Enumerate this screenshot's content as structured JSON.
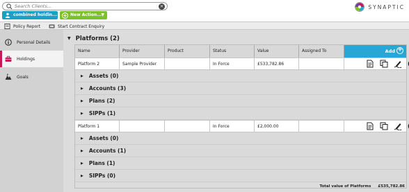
{
  "topbar": {
    "search": {
      "placeholder": "Search Clients...",
      "value": ""
    },
    "client_button": "combined holdin...",
    "action_button": "New Action...",
    "brand": "SYNAPTIC"
  },
  "toolbar": {
    "items": [
      {
        "label": "Policy Report",
        "icon": "report-icon"
      },
      {
        "label": "Start Contract Enquiry",
        "icon": "enquiry-icon"
      }
    ]
  },
  "sidebar": {
    "items": [
      {
        "label": "Personal Details",
        "icon": "info-icon",
        "active": false
      },
      {
        "label": "Holdings",
        "icon": "briefcase-icon",
        "active": true
      },
      {
        "label": "Goals",
        "icon": "goals-icon",
        "active": false
      }
    ]
  },
  "section": {
    "title": "Platforms (2)"
  },
  "table": {
    "headers": [
      "Name",
      "Provider",
      "Product",
      "Status",
      "Value",
      "Assigned To"
    ],
    "add_label": "Add",
    "rows": [
      {
        "cells": [
          "Platform 2",
          "Sample Provider",
          "",
          "In Force",
          "£533,782.86",
          ""
        ],
        "groups": [
          "Assets (0)",
          "Accounts (3)",
          "Plans (2)",
          "SIPPs (1)"
        ]
      },
      {
        "cells": [
          "Platform 1",
          "",
          "",
          "In Force",
          "£2,000.00",
          ""
        ],
        "groups": [
          "Assets (0)",
          "Accounts (1)",
          "Plans (1)",
          "SIPPs (0)"
        ]
      }
    ],
    "row_actions": [
      "edit-icon",
      "copy-icon",
      "sign-icon",
      "delete-icon"
    ]
  },
  "total": {
    "label": "Total value of Platforms",
    "value": "£535,782.86"
  },
  "colors": {
    "accent_blue": "#2aa6d5",
    "client_blue": "#1aa0c4",
    "action_green": "#7ec02a",
    "active_pink": "#c8185a"
  }
}
